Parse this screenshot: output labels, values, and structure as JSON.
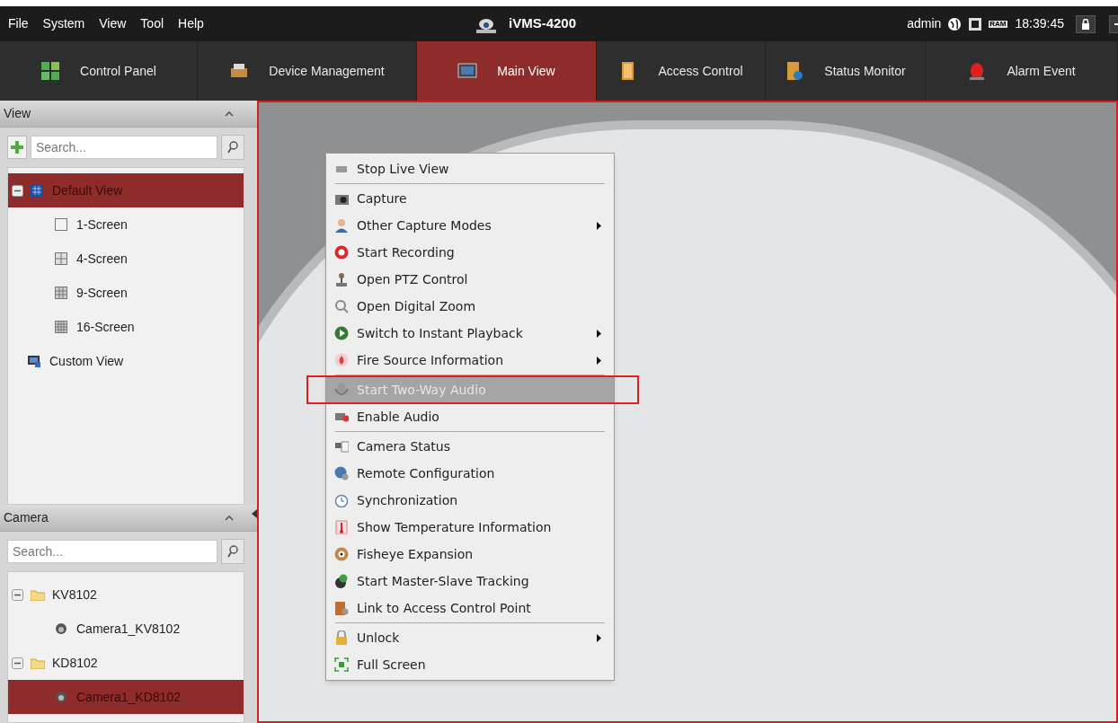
{
  "menu_bar": {
    "items": [
      "File",
      "System",
      "View",
      "Tool",
      "Help"
    ],
    "title": "iVMS-4200",
    "user": "admin",
    "ram_label": "RAM",
    "time": "18:39:45"
  },
  "tabs": [
    {
      "label": "Control Panel",
      "selected": false
    },
    {
      "label": "Device Management",
      "selected": false
    },
    {
      "label": "Main View",
      "selected": true
    },
    {
      "label": "Access Control",
      "selected": false
    },
    {
      "label": "Status Monitor",
      "selected": false
    },
    {
      "label": "Alarm Event",
      "selected": false
    }
  ],
  "view_panel": {
    "title": "View",
    "search": {
      "placeholder": "Search..."
    },
    "tree": [
      {
        "label": "Default View",
        "kind": "group",
        "expanded": true,
        "selected": true,
        "children": [
          {
            "label": "1-Screen",
            "kind": "screen1",
            "selected": false
          },
          {
            "label": "4-Screen",
            "kind": "screen4",
            "selected": false
          },
          {
            "label": "9-Screen",
            "kind": "screen9",
            "selected": false
          },
          {
            "label": "16-Screen",
            "kind": "screen16",
            "selected": false
          }
        ]
      },
      {
        "label": "Custom View",
        "kind": "custom",
        "selected": false
      }
    ]
  },
  "camera_panel": {
    "title": "Camera",
    "search": {
      "placeholder": "Search..."
    },
    "tree": [
      {
        "label": "KV8102",
        "kind": "folder",
        "expanded": true,
        "selected": false,
        "children": [
          {
            "label": "Camera1_KV8102",
            "kind": "camera",
            "selected": false
          }
        ]
      },
      {
        "label": "KD8102",
        "kind": "folder",
        "expanded": true,
        "selected": false,
        "children": [
          {
            "label": "Camera1_KD8102",
            "kind": "camera",
            "selected": true
          }
        ]
      }
    ]
  },
  "context_menu": [
    {
      "kind": "item",
      "label": "Stop Live View",
      "submenu": false,
      "highlighted": false,
      "disabled": false,
      "marked": false
    },
    {
      "kind": "separator"
    },
    {
      "kind": "item",
      "label": "Capture",
      "submenu": false,
      "highlighted": false,
      "disabled": false,
      "marked": false
    },
    {
      "kind": "item",
      "label": "Other Capture Modes",
      "submenu": true,
      "highlighted": false,
      "disabled": false,
      "marked": false
    },
    {
      "kind": "item",
      "label": "Start Recording",
      "submenu": false,
      "highlighted": false,
      "disabled": false,
      "marked": false
    },
    {
      "kind": "item",
      "label": "Open PTZ Control",
      "submenu": false,
      "highlighted": false,
      "disabled": false,
      "marked": false
    },
    {
      "kind": "item",
      "label": "Open Digital Zoom",
      "submenu": false,
      "highlighted": false,
      "disabled": false,
      "marked": false
    },
    {
      "kind": "item",
      "label": "Switch to Instant Playback",
      "submenu": true,
      "highlighted": false,
      "disabled": false,
      "marked": false
    },
    {
      "kind": "item",
      "label": "Fire Source Information",
      "submenu": true,
      "highlighted": false,
      "disabled": false,
      "marked": false
    },
    {
      "kind": "separator"
    },
    {
      "kind": "item",
      "label": "Start Two-Way Audio",
      "submenu": false,
      "highlighted": true,
      "disabled": true,
      "marked": true
    },
    {
      "kind": "item",
      "label": "Enable Audio",
      "submenu": false,
      "highlighted": false,
      "disabled": false,
      "marked": false
    },
    {
      "kind": "separator"
    },
    {
      "kind": "item",
      "label": "Camera Status",
      "submenu": false,
      "highlighted": false,
      "disabled": false,
      "marked": false
    },
    {
      "kind": "item",
      "label": "Remote Configuration",
      "submenu": false,
      "highlighted": false,
      "disabled": false,
      "marked": false
    },
    {
      "kind": "item",
      "label": "Synchronization",
      "submenu": false,
      "highlighted": false,
      "disabled": false,
      "marked": false
    },
    {
      "kind": "item",
      "label": "Show Temperature Information",
      "submenu": false,
      "highlighted": false,
      "disabled": false,
      "marked": false
    },
    {
      "kind": "item",
      "label": "Fisheye Expansion",
      "submenu": false,
      "highlighted": false,
      "disabled": false,
      "marked": false
    },
    {
      "kind": "item",
      "label": "Start Master-Slave Tracking",
      "submenu": false,
      "highlighted": false,
      "disabled": false,
      "marked": false
    },
    {
      "kind": "item",
      "label": "Link to Access Control Point",
      "submenu": false,
      "highlighted": false,
      "disabled": false,
      "marked": false
    },
    {
      "kind": "separator"
    },
    {
      "kind": "item",
      "label": "Unlock",
      "submenu": true,
      "highlighted": false,
      "disabled": false,
      "marked": false
    },
    {
      "kind": "item",
      "label": "Full Screen",
      "submenu": false,
      "highlighted": false,
      "disabled": false,
      "marked": false
    }
  ]
}
